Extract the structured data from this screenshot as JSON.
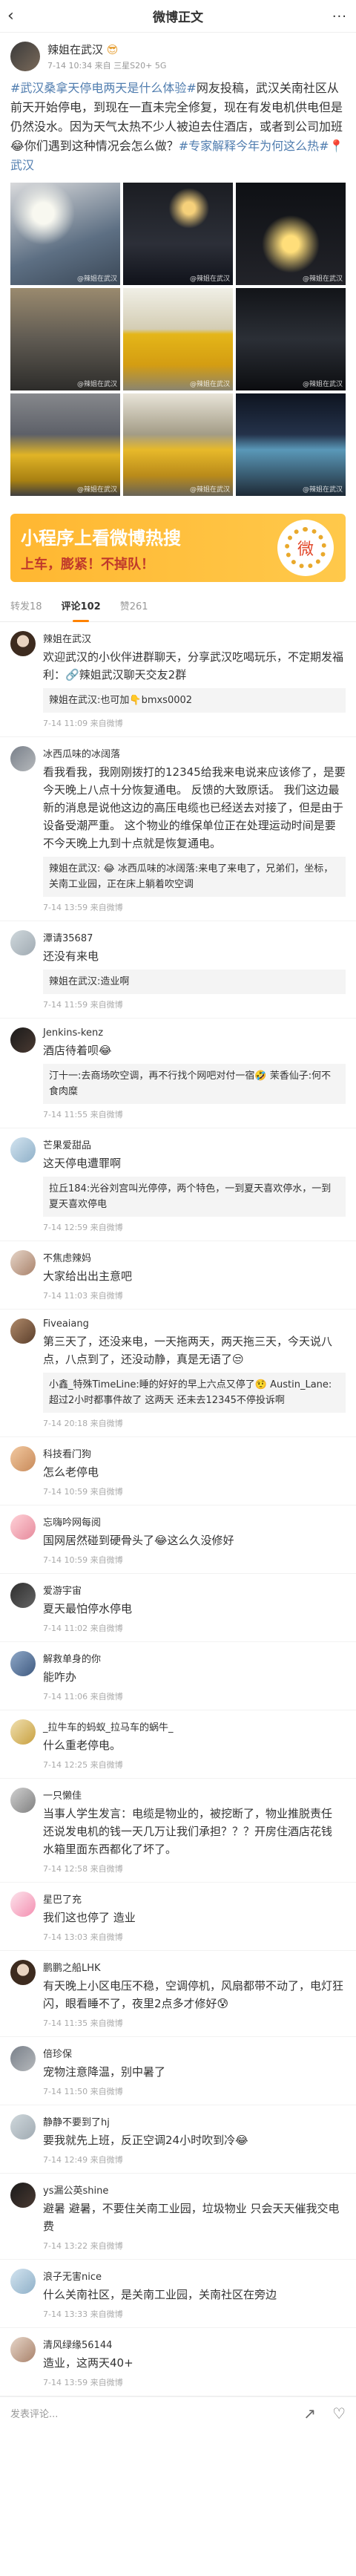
{
  "topbar": {
    "title": "微博正文",
    "back": "‹",
    "more": "···"
  },
  "post": {
    "author": "辣姐在武汉",
    "author_emoji": "😎",
    "sub": "7-14 10:34 来自 三星S20+ 5G",
    "text_prefix": "#武汉桑拿天停电两天是什么体验#",
    "text_body": "网友投稿，武汉关南社区从前天开始停电，到现在一直未完全修复，现在有发电机供电但是仍然没水。因为天气太热不少人被迫去住酒店，或者到公司加班😂你们遇到这种情况会怎么做？",
    "text_suffix": "#专家解释今年为何这么热#",
    "location": "📍武汉",
    "image_watermark": "@辣姐在武汉"
  },
  "ad": {
    "title": "小程序上看微博热搜",
    "sub": "上车，膨紧！不掉队！",
    "qr_glyph": "微"
  },
  "tabs": [
    {
      "label": "转发18"
    },
    {
      "label": "评论102"
    },
    {
      "label": "赞261"
    }
  ],
  "comments": [
    {
      "name": "辣姐在武汉",
      "text": "欢迎武汉的小伙伴进群聊天，分享武汉吃喝玩乐，不定期发福利：🔗辣姐武汉聊天交友2群",
      "time": "7-14 11:09 来自微博",
      "reply": "辣姐在武汉:也可加👇bmxs0002"
    },
    {
      "name": "冰西瓜味的冰阔落",
      "text": "看我看我，我刚刚拨打的12345给我来电说来应该修了，是要今天晚上八点十分恢复通电。 反馈的大致原话。 我们这边最新的消息是说他这边的高压电缆也已经送去对接了，但是由于设备受潮严重。 这个物业的维保单位正在处理运动时间是要不今天晚上九到十点就是恢复通电。",
      "time": "7-14 13:59 来自微博",
      "reply": "辣姐在武汉: 😂 冰西瓜味的冰阔落:来电了来电了，兄弟们，坐标，关南工业园，正在床上躺着吹空调"
    },
    {
      "name": "潭请35687",
      "text": "还没有来电",
      "time": "7-14 11:59 来自微博",
      "reply": "辣姐在武汉:造业啊"
    },
    {
      "name": "Jenkins-kenz",
      "text": "酒店待着呗😂",
      "time": "7-14 11:55 来自微博",
      "reply": "汀十一:去商场吹空调，再不行找个网吧对付一宿🤣 茉香仙子:何不食肉糜"
    },
    {
      "name": "芒果爱甜品",
      "text": "这天停电遭罪啊",
      "time": "7-14 12:59 来自微博",
      "reply": "拉丘184:光谷刘宫叫光停停，两个特色，一到夏天喜欢停水，一到夏天喜欢停电"
    },
    {
      "name": "不焦虑辣妈",
      "text": "大家给出出主意吧",
      "time": "7-14 11:03 来自微博",
      "reply": ""
    },
    {
      "name": "Fiveaiang",
      "text": "第三天了，还没来电，一天拖两天，两天拖三天，今天说八点，八点到了，还没动静，真是无语了😒",
      "time": "7-14 20:18 来自微博",
      "reply": "小鑫_特殊TimeLine:睡的好好的早上六点又停了🤨 Austin_Lane:超过2小时都事件故了 这两天 还未去12345不停投诉啊"
    },
    {
      "name": "科技看门狗",
      "text": "怎么老停电",
      "time": "7-14 10:59 来自微博",
      "reply": ""
    },
    {
      "name": "忘嗨吟网每阅",
      "text": "国网居然碰到硬骨头了😂这么久没修好",
      "time": "7-14 10:59 来自微博",
      "reply": ""
    },
    {
      "name": "爱游宇宙",
      "text": "夏天最怕停水停电",
      "time": "7-14 11:02 来自微博",
      "reply": ""
    },
    {
      "name": "解救单身的你",
      "text": "能咋办",
      "time": "7-14 11:06 来自微博",
      "reply": ""
    },
    {
      "name": "_拉牛车的蚂蚁_拉马车的蜗牛_",
      "text": "什么重老停电。",
      "time": "7-14 12:25 来自微博",
      "reply": ""
    },
    {
      "name": "一只懒佳",
      "text": "当事人学生发言：电缆是物业的，被挖断了，物业推脱责任 还说发电机的钱一天几万让我们承担？？？开房住酒店花钱 水箱里面东西都化了坏了。",
      "time": "7-14 12:58 来自微博",
      "reply": ""
    },
    {
      "name": "星巴了充",
      "text": "我们这也停了 造业",
      "time": "7-14 13:03 来自微博",
      "reply": ""
    },
    {
      "name": "鹏鹏之船LHK",
      "text": "有天晚上小区电压不稳，空调停机，风扇都带不动了，电灯狂闪，眼看睡不了，夜里2点多才修好😰",
      "time": "7-14 11:35 来自微博",
      "reply": ""
    },
    {
      "name": "倍珍保",
      "text": "宠物注意降温，别中暑了",
      "time": "7-14 11:50 来自微博",
      "reply": ""
    },
    {
      "name": "静静不要到了hj",
      "text": "要我就先上班，反正空调24小时吹到冷😂",
      "time": "7-14 12:49 来自微博",
      "reply": ""
    },
    {
      "name": "ys漏公英shine",
      "text": "避暑 避暑，不要住关南工业园，垃圾物业 只会天天催我交电费",
      "time": "7-14 13:22 来自微博",
      "reply": ""
    },
    {
      "name": "浪子无害nice",
      "text": "什么关南社区，是关南工业园，关南社区在旁边",
      "time": "7-14 13:33 来自微博",
      "reply": ""
    },
    {
      "name": "清风绿缘56144",
      "text": "造业，这两天40+",
      "time": "7-14 13:59 来自微博",
      "reply": ""
    }
  ],
  "bottombar": {
    "placeholder": "发表评论...",
    "icon_forward": "↗",
    "icon_like": "♡"
  }
}
